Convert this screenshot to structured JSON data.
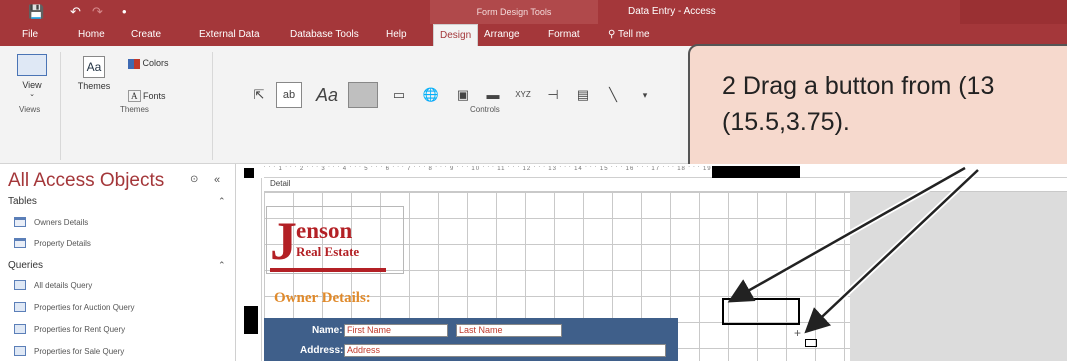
{
  "window": {
    "context_label": "Form Design Tools",
    "app_title": "Data Entry - Access",
    "qat": {
      "save_glyph": "💾",
      "undo_glyph": "↶",
      "redo_glyph": "↷",
      "more_glyph": "•"
    }
  },
  "tabs": [
    {
      "label": "File"
    },
    {
      "label": "Home"
    },
    {
      "label": "Create"
    },
    {
      "label": "External Data"
    },
    {
      "label": "Database Tools"
    },
    {
      "label": "Help"
    },
    {
      "label": "Design"
    },
    {
      "label": "Arrange"
    },
    {
      "label": "Format"
    },
    {
      "label": "Tell me"
    }
  ],
  "ribbon": {
    "view_label": "View",
    "themes_label": "Themes",
    "colors_label": "Colors",
    "fonts_label": "Fonts",
    "groups": {
      "views": "Views",
      "themes": "Themes",
      "controls": "Controls"
    },
    "controls": {
      "label_aa": "Aa",
      "textbox_ab": "ab",
      "xyz": "XYZ"
    }
  },
  "callout": {
    "line1": "2  Drag a button from (13",
    "line2": "(15.5,3.75)."
  },
  "nav": {
    "title": "All Access Objects",
    "sections": [
      {
        "label": "Tables",
        "items": [
          "Owners Details",
          "Property Details"
        ]
      },
      {
        "label": "Queries",
        "items": [
          "All details Query",
          "Properties for Auction Query",
          "Properties for Rent Query",
          "Properties for Sale Query"
        ]
      }
    ]
  },
  "designer": {
    "section_label": "Detail",
    "logo_letter": "J",
    "logo_name": "enson",
    "logo_sub": "Real Estate",
    "heading": "Owner Details:",
    "fields": {
      "name_label": "Name:",
      "first_name": "First Name",
      "last_name": "Last Name",
      "address_label": "Address:",
      "address": "Address"
    }
  },
  "colors": {
    "accent": "#a4373a",
    "logo_red": "#b32025",
    "heading_orange": "#e08a2b",
    "panel_blue": "#3f5f8a",
    "callout_fill": "#f6d9cd"
  }
}
